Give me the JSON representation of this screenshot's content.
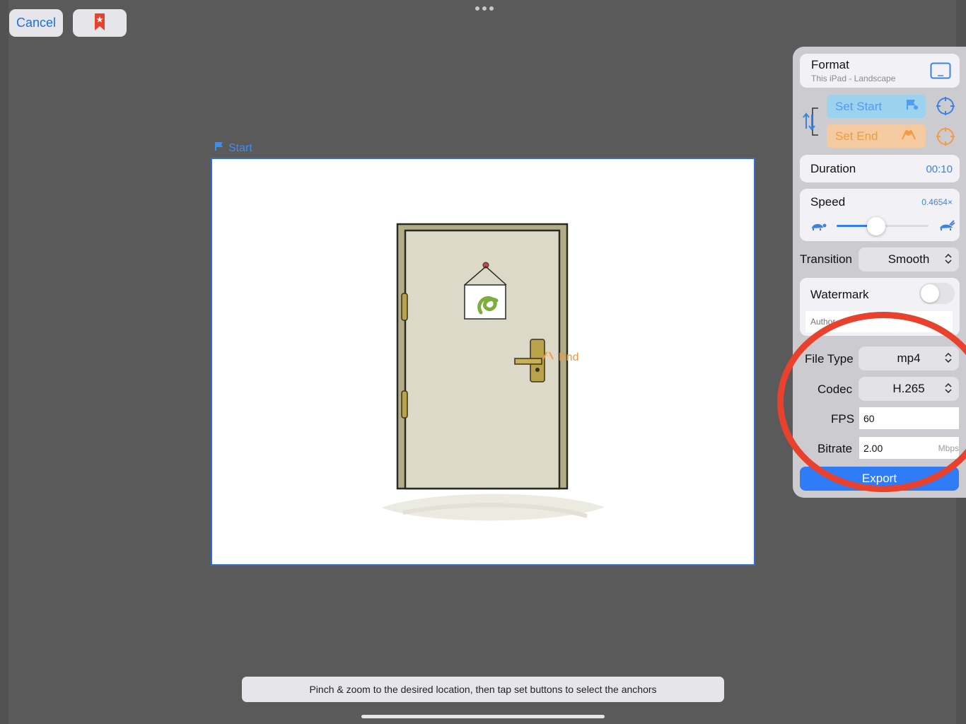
{
  "toolbar": {
    "cancel_label": "Cancel",
    "bookmark_icon": "bookmark-star-icon"
  },
  "canvas": {
    "start_label": "Start",
    "end_label": "End"
  },
  "hint": "Pinch & zoom to the desired location, then tap set buttons to select the anchors",
  "panel": {
    "format": {
      "title": "Format",
      "subtitle": "This iPad - Landscape"
    },
    "set_start_label": "Set Start",
    "set_end_label": "Set End",
    "duration": {
      "label": "Duration",
      "value": "00:10"
    },
    "speed": {
      "label": "Speed",
      "value": "0.4654×",
      "slider_fraction": 0.43
    },
    "transition": {
      "label": "Transition",
      "value": "Smooth"
    },
    "watermark": {
      "label": "Watermark",
      "enabled": false,
      "placeholder": "Author"
    },
    "file_type": {
      "label": "File Type",
      "value": "mp4"
    },
    "codec": {
      "label": "Codec",
      "value": "H.265"
    },
    "fps": {
      "label": "FPS",
      "value": "60"
    },
    "bitrate": {
      "label": "Bitrate",
      "value": "2.00",
      "unit": "Mbps"
    },
    "export_label": "Export"
  },
  "colors": {
    "accent_blue": "#2f7cf6",
    "end_orange": "#f39b3f",
    "annotation_red": "#e8412d",
    "background": "#5a5a5a"
  }
}
